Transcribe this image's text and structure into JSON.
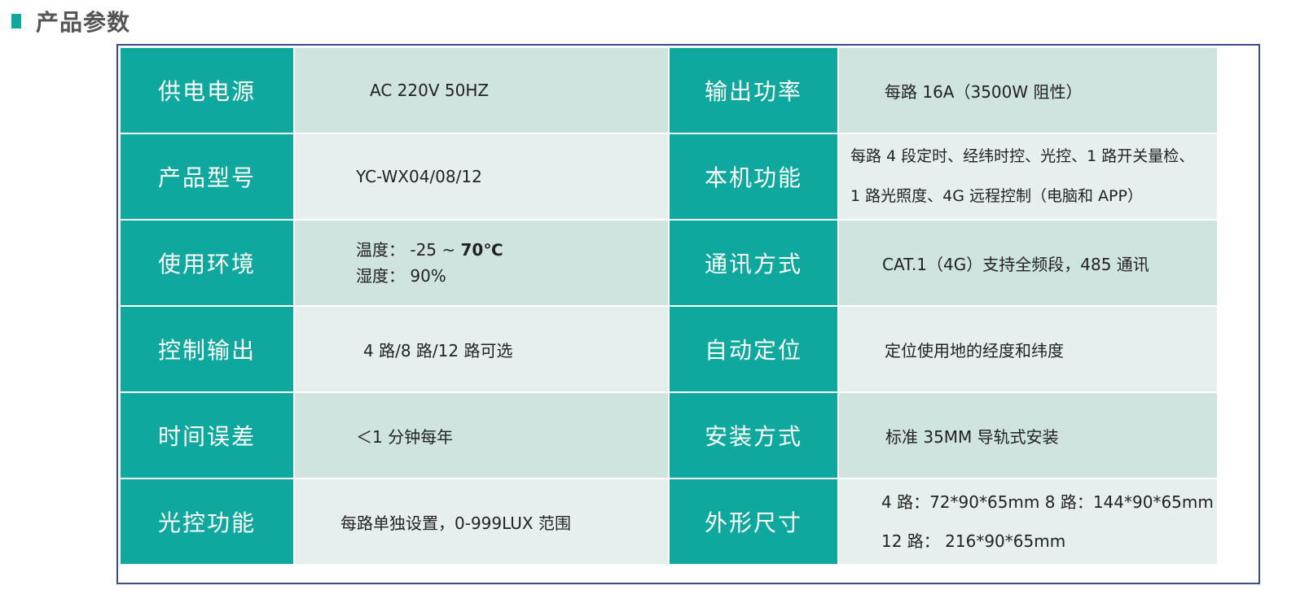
{
  "page_title": "产品参数",
  "colors": {
    "accent": "#0fa89e",
    "row_light": "#cfe3df",
    "row_lighter": "#e5f0ee",
    "frame": "#3a4c8c"
  },
  "rows": [
    {
      "left_label": "供电电源",
      "left_value": [
        "AC 220V 50HZ"
      ],
      "right_label": "输出功率",
      "right_value": [
        "每路 16A（3500W 阻性）"
      ]
    },
    {
      "left_label": "产品型号",
      "left_value": [
        "YC-WX04/08/12"
      ],
      "right_label": "本机功能",
      "right_value": [
        "每路 4 段定时、经纬时控、光控、1 路开关量检、",
        "1 路光照度、4G 远程控制（电脑和 APP）"
      ]
    },
    {
      "left_label": "使用环境",
      "left_value_temp_prefix": "温度：  -25  ~  ",
      "left_value_temp_max": "70℃",
      "left_value_humidity": "湿度：  90%",
      "right_label": "通讯方式",
      "right_value": [
        "CAT.1（4G）支持全频段，485 通讯"
      ]
    },
    {
      "left_label": "控制输出",
      "left_value": [
        "4 路/8 路/12 路可选"
      ],
      "right_label": "自动定位",
      "right_value": [
        "定位使用地的经度和纬度"
      ]
    },
    {
      "left_label": "时间误差",
      "left_value": [
        "＜1 分钟每年"
      ],
      "right_label": "安装方式",
      "right_value": [
        "标准 35MM 导轨式安装"
      ]
    },
    {
      "left_label": "光控功能",
      "left_value": [
        "每路单独设置，0-999LUX 范围"
      ],
      "right_label": "外形尺寸",
      "right_value": [
        "4 路：72*90*65mm    8 路：144*90*65mm",
        "12 路：  216*90*65mm"
      ]
    }
  ]
}
